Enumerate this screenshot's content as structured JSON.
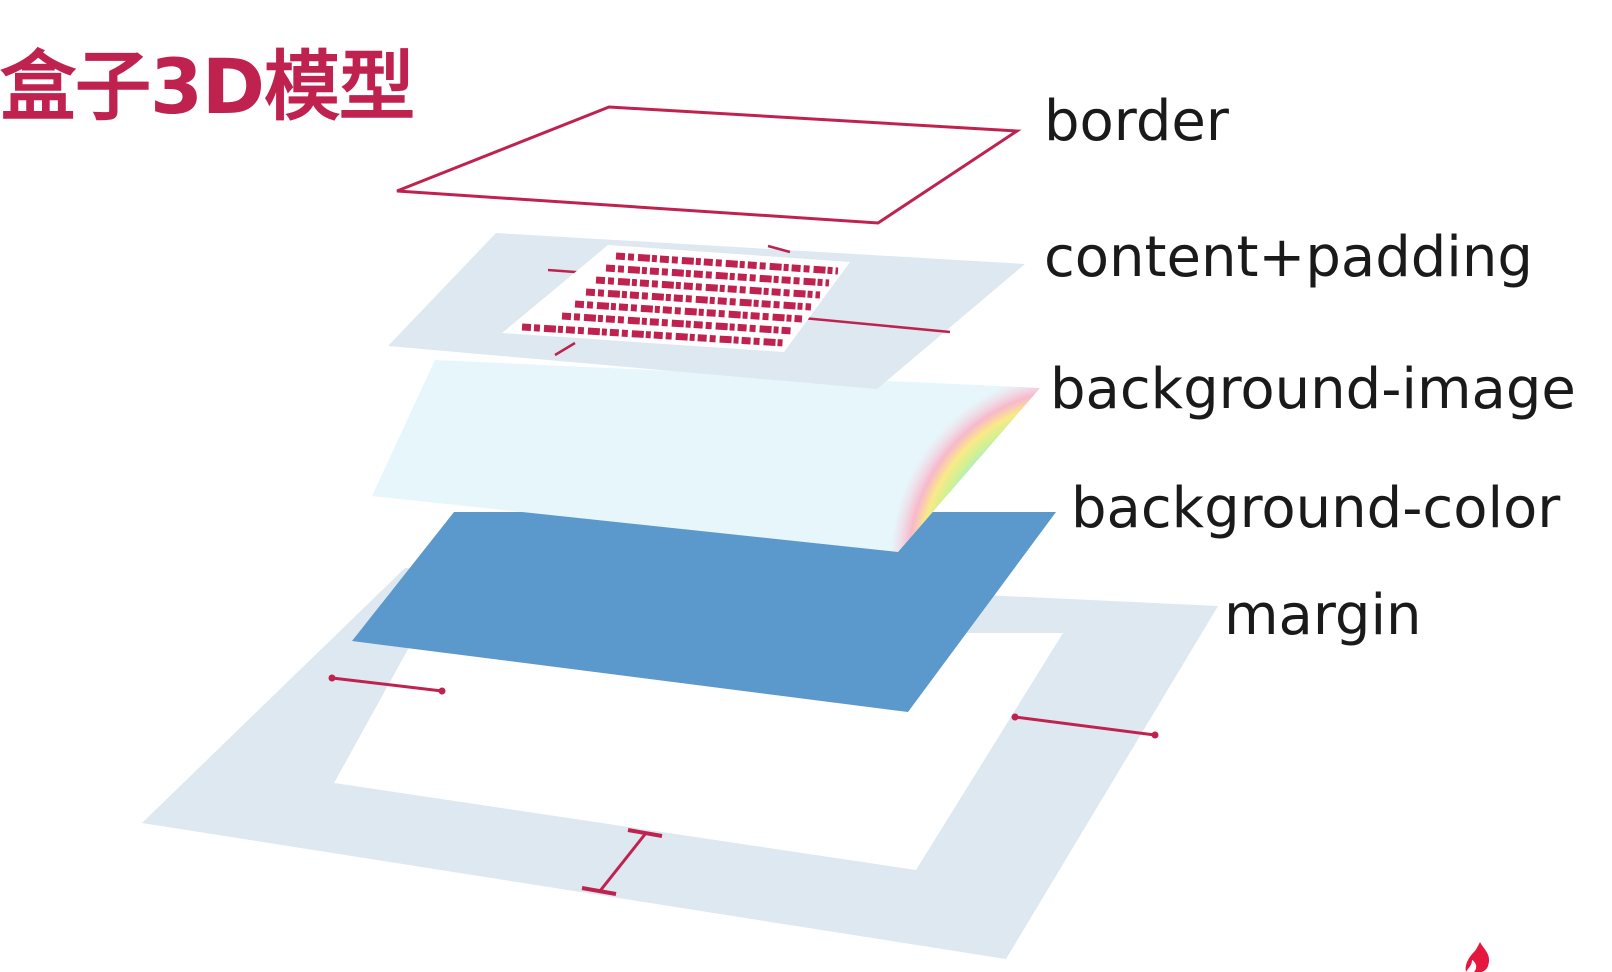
{
  "title": "盒子3D模型",
  "layers": [
    {
      "id": "border",
      "label": "border"
    },
    {
      "id": "content",
      "label": "content+padding"
    },
    {
      "id": "bgimage",
      "label": "background-image"
    },
    {
      "id": "bgcolor",
      "label": "background-color"
    },
    {
      "id": "margin",
      "label": "margin"
    }
  ],
  "colors": {
    "accent": "#c0224f",
    "margin_fill": "#dde8f1",
    "padding_fill": "#dde8f1",
    "bgimage_fill": "#e6f6fb",
    "bgcolor_fill": "#5b98cb",
    "label_text": "#1a1a1a"
  },
  "icons": {
    "watermark": "flame-logo-icon"
  }
}
